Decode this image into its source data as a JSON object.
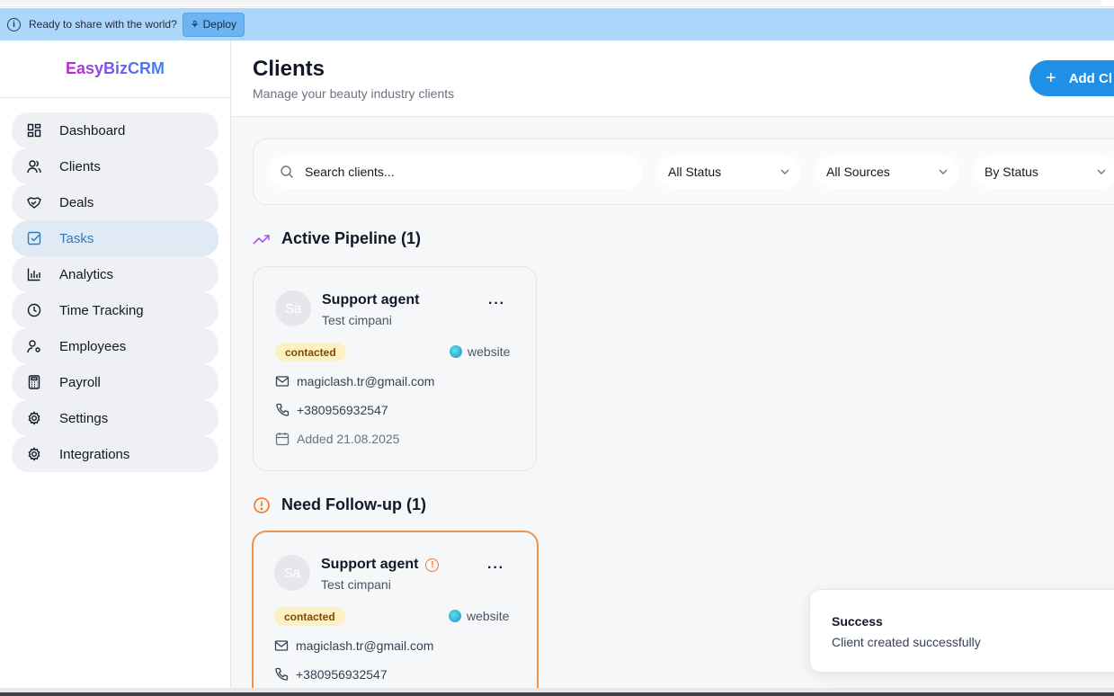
{
  "banner": {
    "message": "Ready to share with the world?",
    "deploy_label": "Deploy"
  },
  "brand": "EasyBizCRM",
  "sidebar": {
    "items": [
      {
        "label": "Dashboard",
        "icon": "grid-icon"
      },
      {
        "label": "Clients",
        "icon": "users-icon"
      },
      {
        "label": "Deals",
        "icon": "handshake-icon"
      },
      {
        "label": "Tasks",
        "icon": "checkbox-icon",
        "active": true
      },
      {
        "label": "Analytics",
        "icon": "bar-chart-icon"
      },
      {
        "label": "Time Tracking",
        "icon": "clock-icon"
      },
      {
        "label": "Employees",
        "icon": "user-gear-icon"
      },
      {
        "label": "Payroll",
        "icon": "calculator-icon"
      },
      {
        "label": "Settings",
        "icon": "gear-icon"
      },
      {
        "label": "Integrations",
        "icon": "gear-icon"
      }
    ]
  },
  "header": {
    "title": "Clients",
    "subtitle": "Manage your beauty industry clients",
    "add_label": "Add Cl"
  },
  "filters": {
    "search_placeholder": "Search clients...",
    "status": "All Status",
    "sources": "All Sources",
    "sort": "By Status"
  },
  "sections": {
    "active": {
      "title": "Active Pipeline (1)"
    },
    "followup": {
      "title": "Need Follow-up (1)"
    }
  },
  "cards": [
    {
      "initials": "Sa",
      "name": "Support agent",
      "company": "Test cimpani",
      "status": "contacted",
      "source": "website",
      "email": "magiclash.tr@gmail.com",
      "phone": "+380956932547",
      "added": "Added 21.08.2025"
    },
    {
      "initials": "Sa",
      "name": "Support agent",
      "company": "Test cimpani",
      "status": "contacted",
      "source": "website",
      "email": "magiclash.tr@gmail.com",
      "phone": "+380956932547"
    }
  ],
  "toast": {
    "title": "Success",
    "message": "Client created successfully"
  },
  "colors": {
    "accent": "#1e90e8",
    "banner": "#add6fb",
    "warning": "#f0944a",
    "badge": "#fdf0c3"
  }
}
